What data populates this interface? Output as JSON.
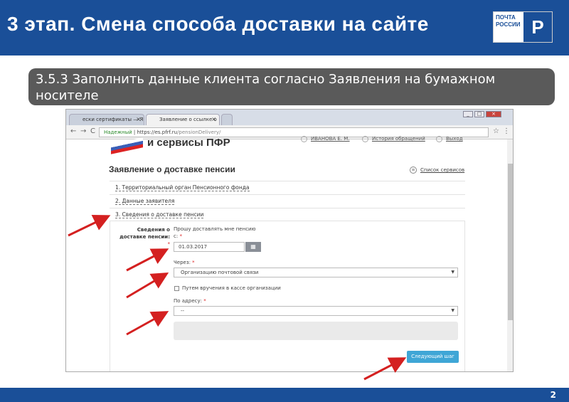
{
  "header": {
    "title": "3 этап. Смена способа доставки на сайте",
    "logo_lines": [
      "ПОЧТА",
      "РОССИИ"
    ],
    "logo_mark": "P"
  },
  "subtitle": "3.5.3 Заполнить данные клиента согласно Заявления на бумажном носителе",
  "browser": {
    "tabs": [
      {
        "label": "ески сертификаты — Я",
        "active": false
      },
      {
        "label": "Заявление о ссылке о",
        "active": true
      }
    ],
    "tab_close": "×",
    "nav_back": "←",
    "nav_forward": "→",
    "nav_reload": "C",
    "url_security": "Надежный",
    "url_host": "https://es.pfrf.ru",
    "url_path": "/pensionDelivery/",
    "star_icon": "☆",
    "menu_icon": "⋮"
  },
  "site": {
    "brand": "и сервисы ПФР",
    "user_name": "ИВАНОВА Е. М.",
    "history_link": "История обращений",
    "logout_link": "Выход",
    "heading": "Заявление о доставке пенсии",
    "services_link": "Список сервисов",
    "steps": [
      "1. Территориальный орган Пенсионного фонда",
      "2. Данные заявителя",
      "3. Сведения о доставке пенсии"
    ]
  },
  "form": {
    "section_label_line1": "Сведения о",
    "section_label_line2": "доставке пенсии:",
    "required_mark": "*",
    "deliver_prompt": "Прошу доставлять мне пенсию",
    "from_label": "с:",
    "date_value": "01.03.2017",
    "via_label": "Через:",
    "via_value": "Организацию почтовой связи",
    "checkbox_label": "Путем вручения в кассе организации",
    "address_label": "По адресу:",
    "address_value": "--",
    "next_button": "Следующий шаг"
  },
  "page_number": "2",
  "colors": {
    "header_bg": "#1a4f98",
    "subtitle_bg": "#5a5a5a",
    "next_button": "#3fa6d6",
    "arrow": "#d42020"
  }
}
